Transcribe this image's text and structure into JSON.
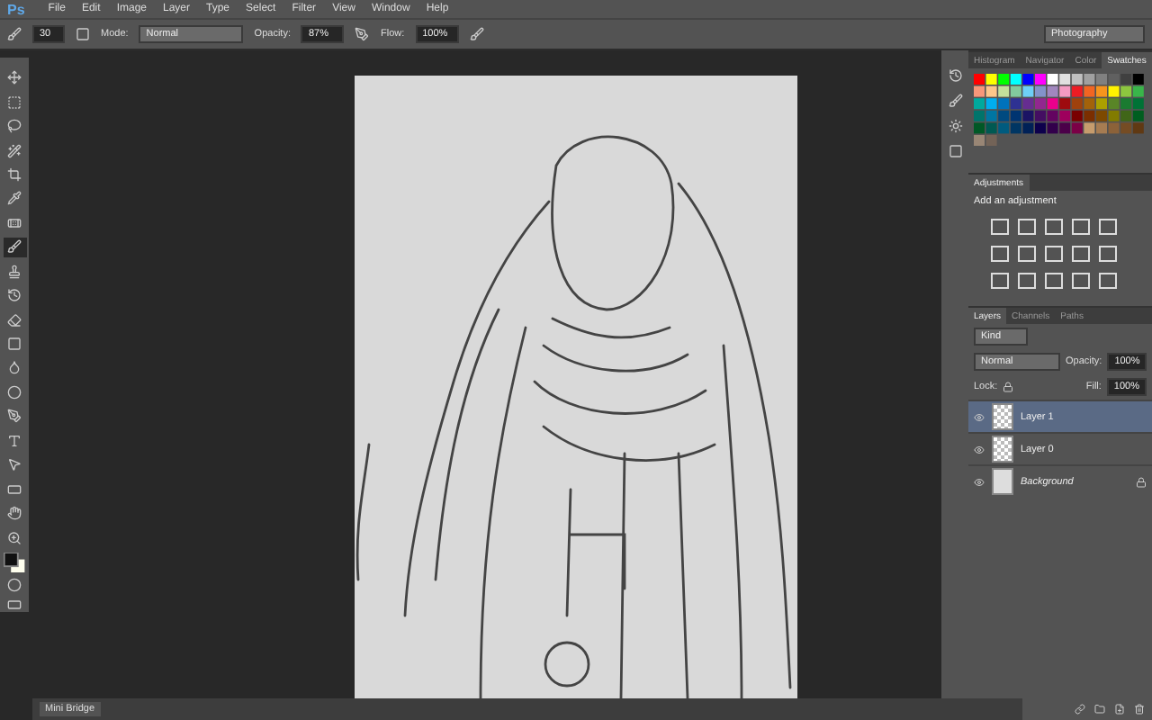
{
  "app": {
    "logo": "Ps"
  },
  "menu": [
    "File",
    "Edit",
    "Image",
    "Layer",
    "Type",
    "Select",
    "Filter",
    "View",
    "Window",
    "Help"
  ],
  "options": {
    "brush_size": "30",
    "mode_label": "Mode:",
    "mode": "Normal",
    "opacity_label": "Opacity:",
    "opacity": "87%",
    "flow_label": "Flow:",
    "flow": "100%"
  },
  "workspace": "Photography",
  "tools": [
    {
      "kind": "move",
      "selected": false
    },
    {
      "kind": "marquee",
      "selected": false
    },
    {
      "kind": "lasso",
      "selected": false
    },
    {
      "kind": "wand",
      "selected": false
    },
    {
      "kind": "crop",
      "selected": false
    },
    {
      "kind": "eyedropper",
      "selected": false
    },
    {
      "kind": "heal",
      "selected": false
    },
    {
      "kind": "brush",
      "selected": true
    },
    {
      "kind": "stamp",
      "selected": false
    },
    {
      "kind": "history",
      "selected": false
    },
    {
      "kind": "eraser",
      "selected": false
    },
    {
      "kind": "gradient",
      "selected": false
    },
    {
      "kind": "blur",
      "selected": false
    },
    {
      "kind": "dodge",
      "selected": false
    },
    {
      "kind": "pen",
      "selected": false
    },
    {
      "kind": "type",
      "selected": false
    },
    {
      "kind": "select",
      "selected": false
    },
    {
      "kind": "shape",
      "selected": false
    },
    {
      "kind": "hand",
      "selected": false
    },
    {
      "kind": "zoom",
      "selected": false
    }
  ],
  "swatch_tabs": [
    {
      "label": "Histogram",
      "selected": false
    },
    {
      "label": "Navigator",
      "selected": false
    },
    {
      "label": "Color",
      "selected": false
    },
    {
      "label": "Swatches",
      "selected": true
    }
  ],
  "adjustments": {
    "title": "Adjustments",
    "hint": "Add an adjustment"
  },
  "layer_tabs": [
    {
      "label": "Layers",
      "selected": true
    },
    {
      "label": "Channels",
      "selected": false
    },
    {
      "label": "Paths",
      "selected": false
    }
  ],
  "layers_panel": {
    "filter": "Kind",
    "blend": "Normal",
    "opacity_label": "Opacity:",
    "opacity": "100%",
    "lock_label": "Lock:",
    "fill_label": "Fill:",
    "fill": "100%"
  },
  "layers": [
    {
      "name": "Layer 1",
      "selected": true,
      "kind": "transparent",
      "locked": false
    },
    {
      "name": "Layer 0",
      "selected": false,
      "kind": "transparent",
      "locked": false
    },
    {
      "name": "Background",
      "selected": false,
      "kind": "solid",
      "locked": true
    }
  ],
  "bottom_panel": {
    "title": "Mini Bridge"
  }
}
